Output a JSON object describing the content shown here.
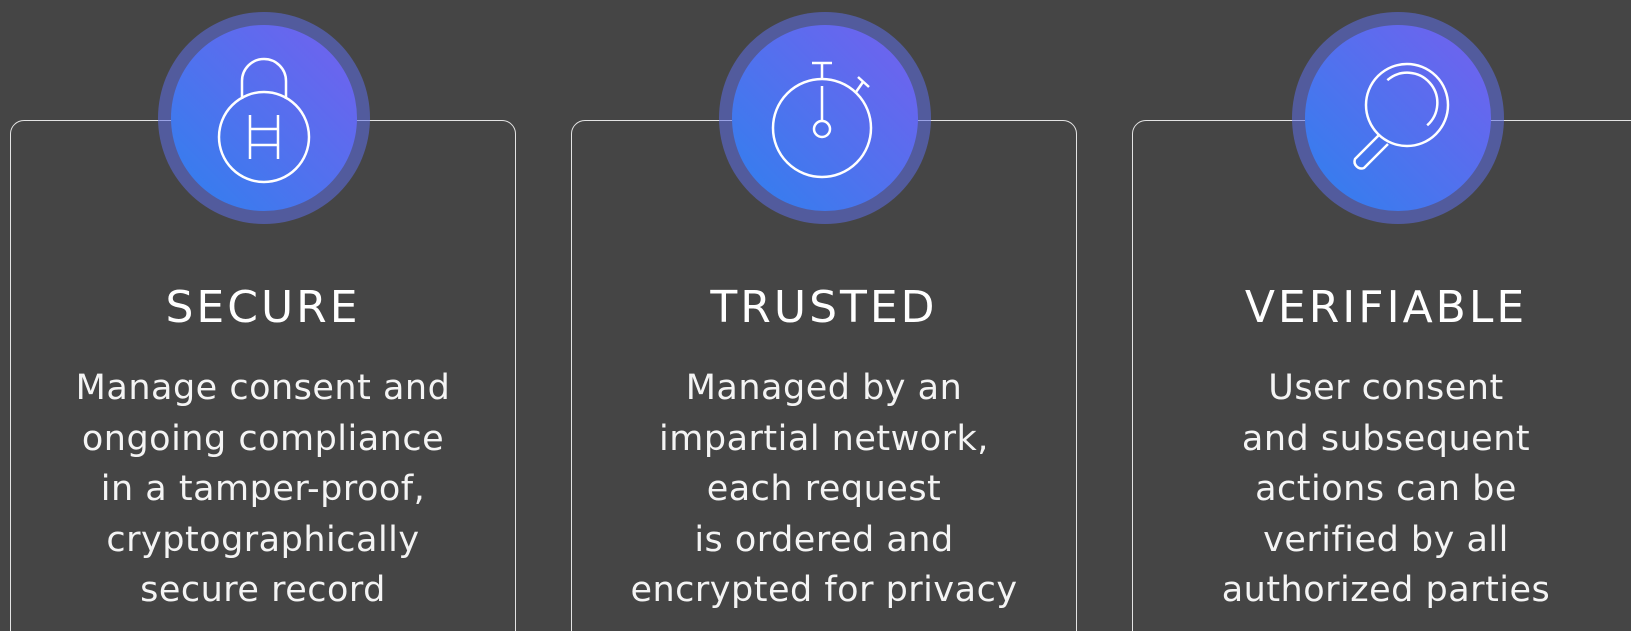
{
  "features": [
    {
      "icon": "lock-hbar-icon",
      "title": "SECURE",
      "lines": [
        "Manage consent and",
        "ongoing compliance",
        "in a tamper-proof,",
        "cryptographically",
        "secure record"
      ]
    },
    {
      "icon": "stopwatch-icon",
      "title": "TRUSTED",
      "lines": [
        "Managed by an",
        "impartial network,",
        "each request",
        "is ordered and",
        "encrypted for privacy"
      ]
    },
    {
      "icon": "magnifier-icon",
      "title": "VERIFIABLE",
      "lines": [
        "User consent",
        "and subsequent",
        "actions can be",
        "verified by all",
        "authorized parties"
      ]
    }
  ],
  "colors": {
    "background": "#454545",
    "badge_ring": "#5c6ee6",
    "badge_gradient_start": "#2f80ee",
    "badge_gradient_end": "#7460ee",
    "text": "#ffffff"
  }
}
